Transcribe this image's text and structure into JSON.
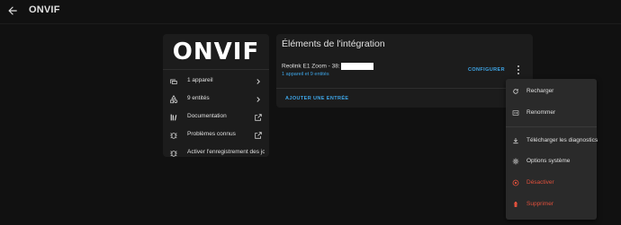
{
  "header": {
    "title": "ONVIF"
  },
  "info_card": {
    "logo_text": "ONVIF",
    "items": [
      {
        "label": "1 appareil",
        "icon": "devices-icon",
        "trail": "chevron-right-icon"
      },
      {
        "label": "9 entités",
        "icon": "shapes-icon",
        "trail": "chevron-right-icon"
      },
      {
        "label": "Documentation",
        "icon": "book-icon",
        "trail": "open-in-new-icon"
      },
      {
        "label": "Problèmes connus",
        "icon": "bug-icon",
        "trail": "open-in-new-icon"
      },
      {
        "label": "Activer l'enregistrement des jo...",
        "icon": "bug-icon",
        "trail": ""
      }
    ]
  },
  "integration_card": {
    "title": "Éléments de l'intégration",
    "entry_name": "Reolink E1 Zoom - 38:",
    "entry_sub": "1 appareil et 9 entités",
    "configure_label": "CONFIGURER",
    "add_entry_label": "AJOUTER UNE ENTRÉE"
  },
  "menu": {
    "items": [
      {
        "label": "Recharger",
        "icon": "reload-icon"
      },
      {
        "label": "Renommer",
        "icon": "rename-icon"
      },
      {
        "label": "Télécharger les diagnostics",
        "icon": "download-icon"
      },
      {
        "label": "Options système",
        "icon": "gear-icon"
      },
      {
        "label": "Désactiver",
        "icon": "stop-circle-icon"
      },
      {
        "label": "Supprimer",
        "icon": "trash-icon"
      }
    ]
  },
  "colors": {
    "accent": "#3ea6e8",
    "danger": "#e0503c",
    "background": "#111111",
    "card": "#1c1c1c"
  }
}
